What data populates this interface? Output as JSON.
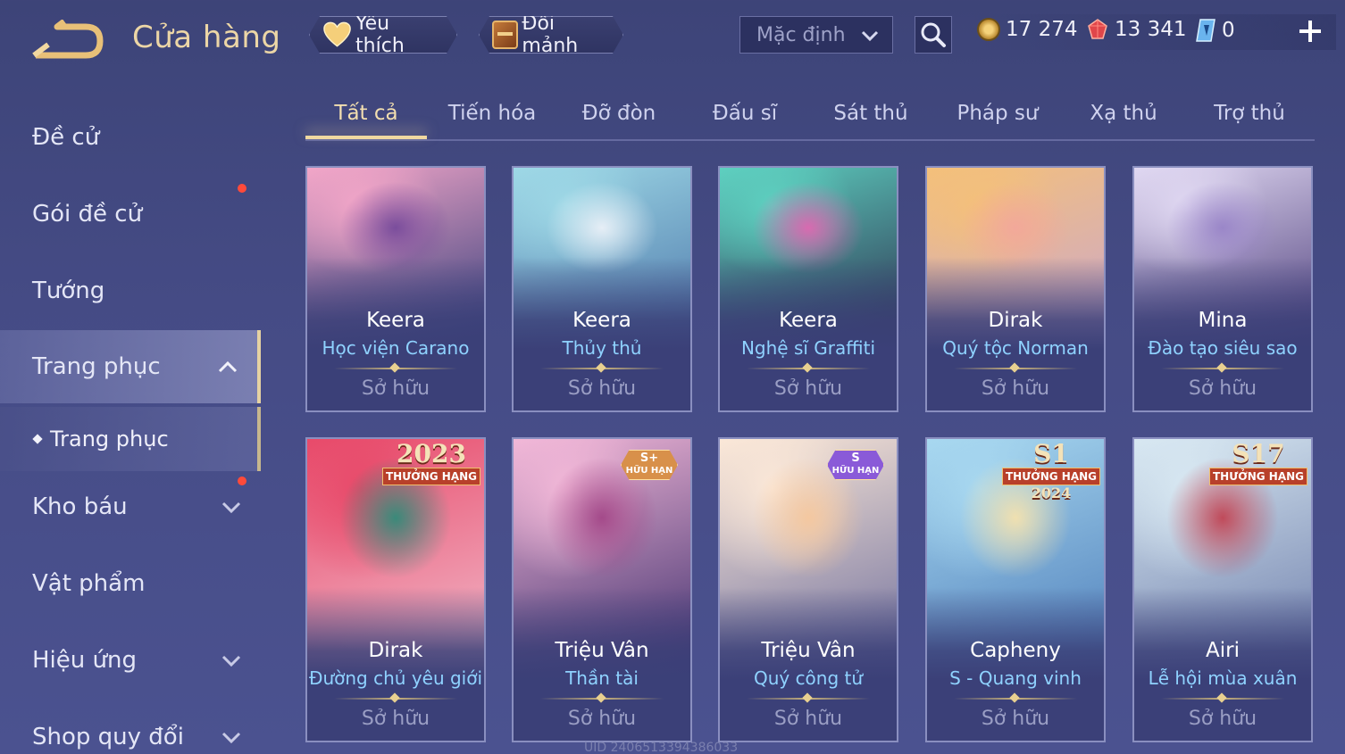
{
  "header": {
    "title": "Cửa hàng",
    "favorite_label": "Yêu thích",
    "shard_label": "Đổi mảnh",
    "sort_value": "Mặc định",
    "currencies": {
      "gold": "17 274",
      "ruby": "13 341",
      "gem": "0"
    }
  },
  "sidebar": {
    "items": [
      {
        "label": "Đề cử"
      },
      {
        "label": "Gói đề cử"
      },
      {
        "label": "Tướng"
      },
      {
        "label": "Trang phục"
      },
      {
        "label": "Trang phục"
      },
      {
        "label": "Kho báu"
      },
      {
        "label": "Vật phẩm"
      },
      {
        "label": "Hiệu ứng"
      },
      {
        "label": "Shop quy đổi"
      }
    ]
  },
  "tabs": [
    "Tất cả",
    "Tiến hóa",
    "Đỡ đòn",
    "Đấu sĩ",
    "Sát thủ",
    "Pháp sư",
    "Xạ thủ",
    "Trợ thủ"
  ],
  "cards": [
    {
      "hero": "Keera",
      "skin": "Học viện Carano",
      "status": "Sở hữu",
      "palette": [
        "#f2a6c8",
        "#7a4d9c",
        "#2d3a78"
      ]
    },
    {
      "hero": "Keera",
      "skin": "Thủy thủ",
      "status": "Sở hữu",
      "palette": [
        "#9ed8e6",
        "#e6eef6",
        "#4a74a8"
      ]
    },
    {
      "hero": "Keera",
      "skin": "Nghệ sĩ Graffiti",
      "status": "Sở hữu",
      "palette": [
        "#5ed0c0",
        "#d86ab0",
        "#2a2a4a"
      ]
    },
    {
      "hero": "Dirak",
      "skin": "Quý tộc Norman",
      "status": "Sở hữu",
      "palette": [
        "#f4c07a",
        "#f2a89a",
        "#c9a6d0"
      ]
    },
    {
      "hero": "Mina",
      "skin": "Đào tạo siêu sao",
      "status": "Sở hữu",
      "palette": [
        "#e0d8f2",
        "#9a86c8",
        "#4a3a78"
      ]
    },
    {
      "hero": "Dirak",
      "skin": "Đường chủ yêu giới",
      "status": "Sở hữu",
      "palette": [
        "#e84a6a",
        "#3a8a7a",
        "#f2c0d0"
      ],
      "badge": {
        "type": "year",
        "top": "2023",
        "ribbon": "THƯỞNG HẠNG"
      }
    },
    {
      "hero": "Triệu Vân",
      "skin": "Thần tài",
      "status": "Sở hữu",
      "palette": [
        "#f2b8d8",
        "#a44a8a",
        "#3a2a6a"
      ],
      "badge": {
        "type": "limited",
        "top": "S+",
        "ribbon": "HỮU HẠN",
        "color": "#d8904a"
      }
    },
    {
      "hero": "Triệu Vân",
      "skin": "Quý công tử",
      "status": "Sở hữu",
      "palette": [
        "#fbe8d8",
        "#f4c8a0",
        "#6a6a9a"
      ],
      "badge": {
        "type": "limited",
        "top": "S",
        "ribbon": "HỮU HẠN",
        "color": "#8a5ad8"
      }
    },
    {
      "hero": "Capheny",
      "skin": "S - Quang vinh",
      "status": "Sở hữu",
      "palette": [
        "#a8d8f0",
        "#f0e0b0",
        "#4a7ab8"
      ],
      "badge": {
        "type": "year",
        "top": "S1",
        "ribbon": "THƯỞNG HẠNG",
        "sub": "2024"
      }
    },
    {
      "hero": "Airi",
      "skin": "Lễ hội mùa xuân",
      "status": "Sở hữu",
      "palette": [
        "#d8e8f2",
        "#c04a5a",
        "#6a7aa8"
      ],
      "badge": {
        "type": "year",
        "top": "S17",
        "ribbon": "THƯỞNG HẠNG"
      }
    }
  ],
  "footer": {
    "uid": "UID 2406513394386033"
  }
}
